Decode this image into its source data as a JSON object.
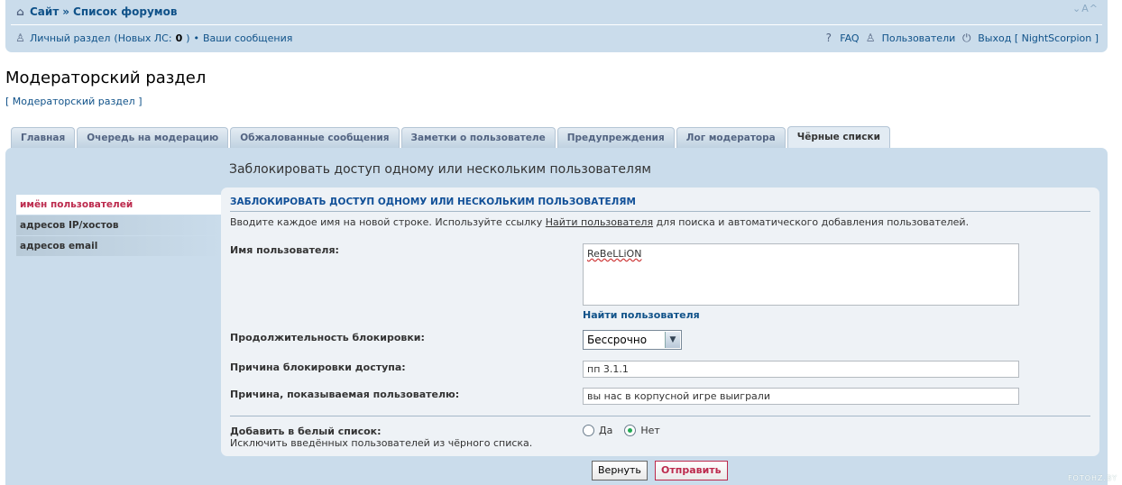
{
  "header": {
    "home_icon": "home-icon",
    "site_link": "Сайт",
    "sep": "»",
    "forums_link": "Список форумов",
    "font_controls": "⌄A^",
    "ucp_link": "Личный раздел",
    "new_pm_prefix": "(Новых ЛС: ",
    "new_pm_count": "0",
    "new_pm_suffix": ")",
    "bullet": "•",
    "your_posts": "Ваши сообщения",
    "faq": "FAQ",
    "members": "Пользователи",
    "logout": "Выход [ NightScorpion ]"
  },
  "page": {
    "title": "Модераторский раздел",
    "breadcrumb_open": "[ ",
    "breadcrumb_link": "Модераторский раздел",
    "breadcrumb_close": " ]"
  },
  "tabs": [
    {
      "label": "Главная",
      "active": false
    },
    {
      "label": "Очередь на модерацию",
      "active": false
    },
    {
      "label": "Обжалованные сообщения",
      "active": false
    },
    {
      "label": "Заметки о пользователе",
      "active": false
    },
    {
      "label": "Предупреждения",
      "active": false
    },
    {
      "label": "Лог модератора",
      "active": false
    },
    {
      "label": "Чёрные списки",
      "active": true
    }
  ],
  "main": {
    "heading": "Заблокировать доступ одному или нескольким пользователям",
    "side_menu": [
      {
        "label": "имён пользователей",
        "active": true
      },
      {
        "label": "адресов IP/хостов",
        "active": false
      },
      {
        "label": "адресов email",
        "active": false
      }
    ],
    "section_title": "ЗАБЛОКИРОВАТЬ ДОСТУП ОДНОМУ ИЛИ НЕСКОЛЬКИМ ПОЛЬЗОВАТЕЛЯМ",
    "intro_before": "Вводите каждое имя на новой строке. Используйте ссылку ",
    "intro_link": "Найти пользователя",
    "intro_after": " для поиска и автоматического добавления пользователей.",
    "username_label": "Имя пользователя:",
    "username_value": "ReBeLLiON",
    "find_user": "Найти пользователя",
    "duration_label": "Продолжительность блокировки:",
    "duration_value": "Бессрочно",
    "reason_label": "Причина блокировки доступа:",
    "reason_value": "пп 3.1.1",
    "shown_reason_label": "Причина, показываемая пользователю:",
    "shown_reason_value": "вы нас в корпусной игре выиграли",
    "whitelist_label": "Добавить в белый список:",
    "whitelist_explain": "Исключить введённых пользователей из чёрного списка.",
    "yes": "Да",
    "no": "Нет",
    "whitelist_selected": "no",
    "reset_button": "Вернуть",
    "submit_button": "Отправить"
  },
  "watermark": "FOTOHZ.BY"
}
